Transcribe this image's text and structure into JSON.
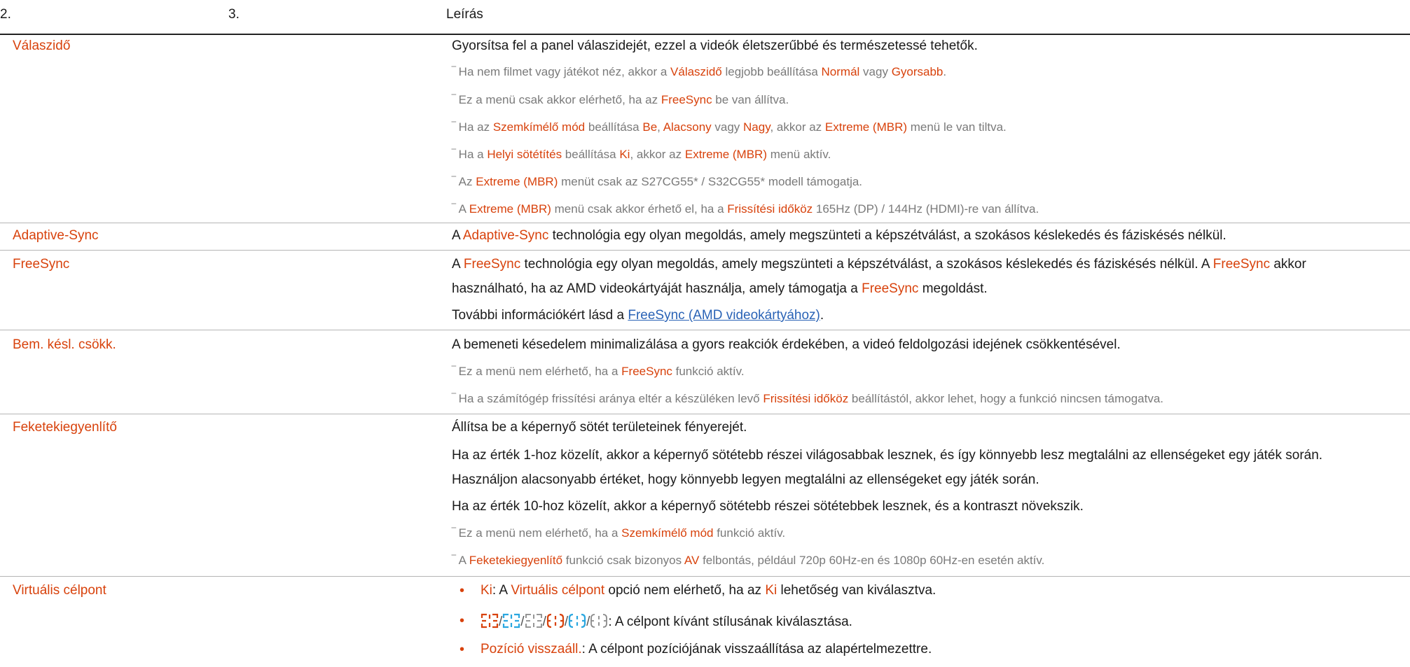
{
  "headers": {
    "col2": "2.",
    "col3": "3.",
    "col_desc": "Leírás"
  },
  "valaszido": {
    "term": "Válaszidő",
    "main": "Gyorsítsa fel a panel válaszidejét, ezzel a videók életszerűbbé és természetessé tehetők.",
    "n1": {
      "a": "Ha nem filmet vagy játékot néz, akkor a ",
      "b": "Válaszidő",
      "c": " legjobb beállítása ",
      "d": "Normál",
      "e": " vagy ",
      "f": "Gyorsabb",
      "g": "."
    },
    "n2": {
      "a": "Ez a menü csak akkor elérhető, ha az ",
      "b": "FreeSync",
      "c": " be van állítva."
    },
    "n3": {
      "a": "Ha az ",
      "b": "Szemkímélő mód",
      "c": " beállítása ",
      "d": "Be",
      "e": ", ",
      "f": "Alacsony",
      "g": " vagy ",
      "h": "Nagy",
      "i": ", akkor az ",
      "j": "Extreme (MBR)",
      "k": " menü le van tiltva."
    },
    "n4": {
      "a": "Ha a ",
      "b": "Helyi sötétítés",
      "c": " beállítása ",
      "d": "Ki",
      "e": ", akkor az ",
      "f": "Extreme (MBR)",
      "g": " menü aktív."
    },
    "n5": {
      "a": "Az ",
      "b": "Extreme (MBR)",
      "c": " menüt csak az S27CG55* / S32CG55* modell támogatja."
    },
    "n6": {
      "a": "A ",
      "b": "Extreme (MBR)",
      "c": " menü csak akkor érhető el, ha a ",
      "d": "Frissítési időköz",
      "e": " 165Hz (DP) / 144Hz (HDMI)-re van állítva."
    }
  },
  "adaptive": {
    "term": "Adaptive-Sync",
    "a": "A ",
    "b": "Adaptive-Sync",
    "c": " technológia egy olyan megoldás, amely megszünteti a képszétválást, a szokásos késlekedés és fáziskésés nélkül."
  },
  "freesync": {
    "term": "FreeSync",
    "l1": {
      "a": "A ",
      "b": "FreeSync",
      "c": " technológia egy olyan megoldás, amely megszünteti a képszétválást, a szokásos késlekedés és fáziskésés nélkül. A ",
      "d": "FreeSync",
      "e": " akkor"
    },
    "l2": {
      "a": "használható, ha az AMD videokártyáját használja, amely támogatja a ",
      "b": "FreeSync",
      "c": " megoldást."
    },
    "l3": {
      "a": "További információkért lásd a ",
      "link": "FreeSync (AMD videokártyához)",
      "c": "."
    }
  },
  "bem": {
    "term": "Bem. késl. csökk.",
    "main": "A bemeneti késedelem minimalizálása a gyors reakciók érdekében, a videó feldolgozási idejének csökkentésével.",
    "n1": {
      "a": "Ez a menü nem elérhető, ha a ",
      "b": "FreeSync",
      "c": " funkció aktív."
    },
    "n2": {
      "a": "Ha a számítógép frissítési aránya eltér a készüléken levő ",
      "b": "Frissítési időköz",
      "c": " beállítástól, akkor lehet, hogy a funkció nincsen támogatva."
    }
  },
  "fekete": {
    "term": "Feketekiegyenlítő",
    "l1": "Állítsa be a képernyő sötét területeinek fényerejét.",
    "l2": "Ha az érték 1-hoz közelít, akkor a képernyő sötétebb részei világosabbak lesznek, és így könnyebb lesz megtalálni az ellenségeket egy játék során.",
    "l3": "Használjon alacsonyabb értéket, hogy könnyebb legyen megtalálni az ellenségeket egy játék során.",
    "l4": "Ha az érték 10-hoz közelít, akkor a képernyő sötétebb részei sötétebbek lesznek, és a kontraszt növekszik.",
    "n1": {
      "a": "Ez a menü nem elérhető, ha a ",
      "b": "Szemkímélő mód",
      "c": " funkció aktív."
    },
    "n2": {
      "a": "A ",
      "b": "Feketekiegyenlítő",
      "c": " funkció csak bizonyos ",
      "d": "AV",
      "e": " felbontás, például 720p 60Hz-en és 1080p 60Hz-en esetén aktív."
    }
  },
  "virtualis": {
    "term": "Virtuális célpont",
    "b1": {
      "a": "Ki",
      "b": ": A ",
      "c": "Virtuális célpont",
      "d": " opció nem elérhető, ha az ",
      "e": "Ki",
      "f": " lehetőség van kiválasztva."
    },
    "b2": {
      "sep": "/",
      "tail": ": A célpont kívánt stílusának kiválasztása."
    },
    "b3": {
      "a": "Pozíció visszaáll.",
      "b": ": A célpont pozíciójának visszaállítása az alapértelmezettre."
    }
  },
  "colors": {
    "accent": "#d8420c",
    "cyan": "#2aa7e0",
    "gray": "#8a8a8a",
    "link": "#2a63b6"
  }
}
